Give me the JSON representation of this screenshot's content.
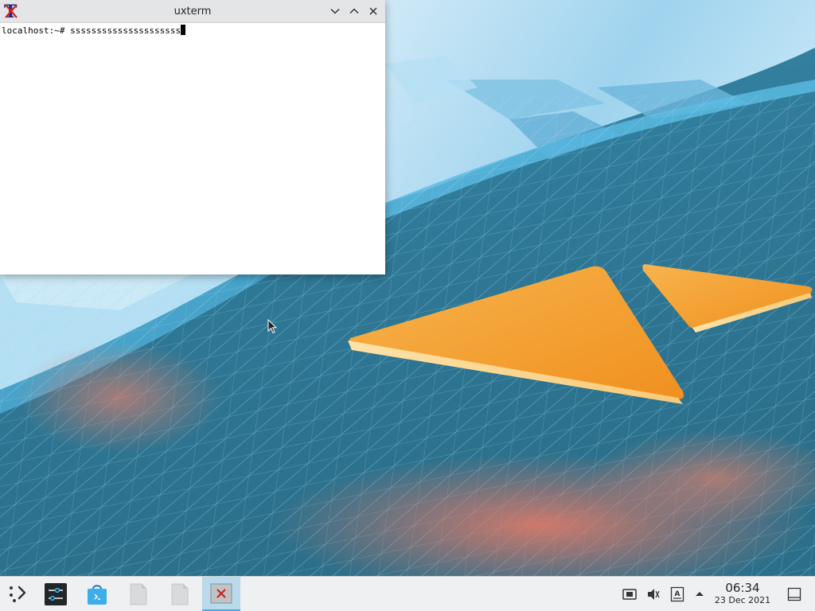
{
  "window": {
    "title": "uxterm",
    "app_icon": "xterm-app-icon",
    "controls": [
      "minimize-icon",
      "maximize-icon",
      "close-icon"
    ]
  },
  "terminal": {
    "prompt": "localhost:~# ",
    "input": "sssssssssssssssssssss"
  },
  "taskbar": {
    "launcher_icon": "application-launcher-icon",
    "tasks": [
      {
        "icon": "system-settings-icon"
      },
      {
        "icon": "discover-store-icon"
      },
      {
        "icon": "file-icon"
      },
      {
        "icon": "file-icon"
      },
      {
        "icon": "xterm-task-icon",
        "active": true
      }
    ],
    "tray": {
      "icons": [
        "network-icon",
        "volume-muted-icon",
        "keyboard-layout-icon",
        "tray-expand-icon"
      ],
      "clock_time": "06:34",
      "clock_date": "23 Dec 2021"
    },
    "show_desktop_icon": "show-desktop-icon"
  },
  "colors": {
    "accent": "#3daee9",
    "taskbar_bg": "#eff0f1",
    "titlebar_bg": "#e3e5e7",
    "wallpaper_orange": "#f5a43a",
    "wallpaper_teal": "#2f7795"
  }
}
